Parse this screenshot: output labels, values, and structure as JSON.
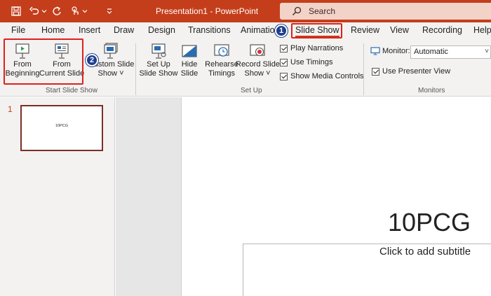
{
  "window": {
    "title": "Presentation1  -  PowerPoint"
  },
  "search": {
    "label": "Search"
  },
  "tabs": [
    {
      "label": "File"
    },
    {
      "label": "Home"
    },
    {
      "label": "Insert"
    },
    {
      "label": "Draw"
    },
    {
      "label": "Design"
    },
    {
      "label": "Transitions"
    },
    {
      "label": "Animations"
    },
    {
      "label": "Slide Show"
    },
    {
      "label": "Review"
    },
    {
      "label": "View"
    },
    {
      "label": "Recording"
    },
    {
      "label": "Help"
    }
  ],
  "active_tab": "Slide Show",
  "ribbon": {
    "start_group": {
      "label": "Start Slide Show",
      "from_beginning": [
        "From",
        "Beginning"
      ],
      "from_current": [
        "From",
        "Current Slide"
      ],
      "custom_show": [
        "Custom Slide",
        "Show"
      ]
    },
    "setup_group": {
      "label": "Set Up",
      "setup_show": [
        "Set Up",
        "Slide Show"
      ],
      "hide_slide": [
        "Hide",
        "Slide"
      ],
      "rehearse": [
        "Rehearse",
        "Timings"
      ],
      "record": [
        "Record Slide",
        "Show"
      ],
      "checkboxes": [
        {
          "label": "Play Narrations",
          "checked": true
        },
        {
          "label": "Use Timings",
          "checked": true
        },
        {
          "label": "Show Media Controls",
          "checked": true
        }
      ]
    },
    "monitors_group": {
      "label": "Monitors",
      "monitor_label": "Monitor:",
      "monitor_value": "Automatic",
      "presenter_view": {
        "label": "Use Presenter View",
        "checked": true
      }
    }
  },
  "annotations": {
    "badge1": "1",
    "badge2": "2"
  },
  "slides": [
    {
      "number": "1",
      "title": "10PCG"
    }
  ],
  "slide": {
    "title": "10PCG",
    "subtitle_placeholder": "Click to add subtitle"
  },
  "colors": {
    "accent": "#c43e1c",
    "annotation_red": "#e0201b",
    "badge_blue": "#1e3f8f"
  }
}
